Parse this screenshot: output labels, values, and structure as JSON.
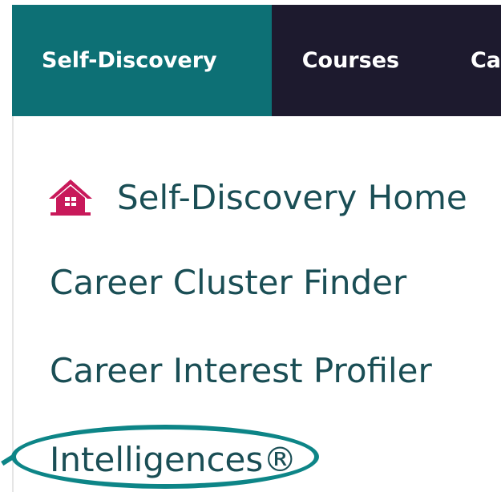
{
  "nav": {
    "tabs": [
      {
        "label": "Self-Discovery",
        "active": true
      },
      {
        "label": "Courses",
        "active": false
      },
      {
        "label": "Ca",
        "active": false
      }
    ]
  },
  "menu": {
    "items": [
      {
        "label": "Self-Discovery Home",
        "icon": "home-icon"
      },
      {
        "label": "Career Cluster Finder"
      },
      {
        "label": "Career Interest Profiler"
      },
      {
        "label": "Intelligences®",
        "highlighted": true
      }
    ]
  },
  "colors": {
    "nav_background": "#1d1a2e",
    "active_tab": "#0d7075",
    "menu_text": "#1a4e55",
    "home_icon": "#c8195a",
    "highlight_ring": "#0d8587"
  }
}
